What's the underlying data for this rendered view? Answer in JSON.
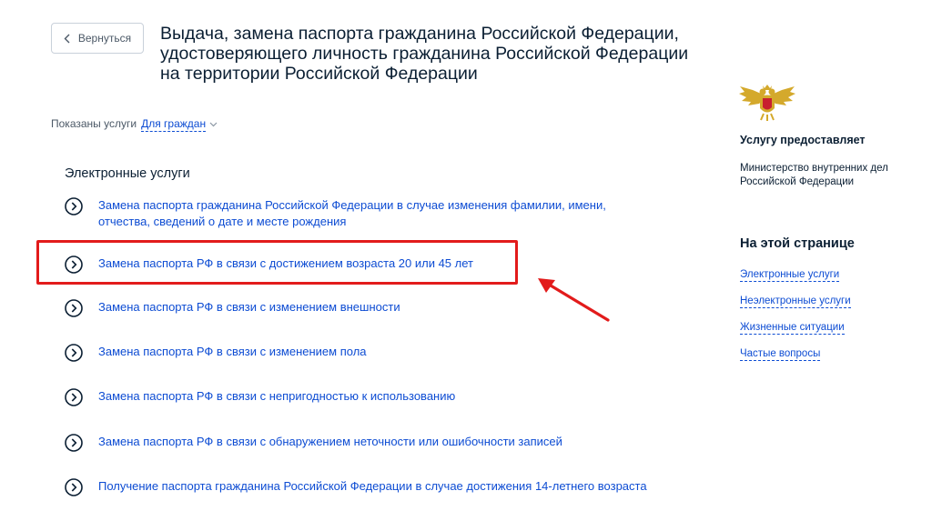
{
  "header": {
    "back_label": "Вернуться",
    "title": "Выдача, замена паспорта гражданина Российской Федерации, удостоверяющего личность гражданина Российской Федерации на территории Российской Федерации"
  },
  "filter": {
    "prefix": "Показаны услуги",
    "value": "Для граждан"
  },
  "main": {
    "section_heading": "Электронные услуги",
    "services": [
      {
        "label": "Замена паспорта гражданина Российской Федерации в случае изменения фамилии, имени, отчества, сведений о дате и месте рождения"
      },
      {
        "label": "Замена паспорта РФ в связи с достижением возраста 20 или 45 лет"
      },
      {
        "label": "Замена паспорта РФ в связи с изменением внешности"
      },
      {
        "label": "Замена паспорта РФ в связи с изменением пола"
      },
      {
        "label": "Замена паспорта РФ в связи с непригодностью к использованию"
      },
      {
        "label": "Замена паспорта РФ в связи с обнаружением неточности или ошибочности записей"
      },
      {
        "label": "Получение паспорта гражданина Российской Федерации в случае достижения 14-летнего возраста"
      }
    ]
  },
  "sidebar": {
    "provider_title": "Услугу предоставляет",
    "provider_name": "Министерство внутренних дел Российской Федерации",
    "toc_title": "На этой странице",
    "toc_links": [
      {
        "label": "Электронные услуги"
      },
      {
        "label": "Неэлектронные услуги"
      },
      {
        "label": "Жизненные ситуации"
      },
      {
        "label": "Частые вопросы"
      }
    ]
  },
  "colors": {
    "link": "#0d4cd3",
    "text": "#0b1f33",
    "highlight": "#e21b1b",
    "emblem_gold": "#d4a92c"
  },
  "icons": [
    "chevron-left-icon",
    "chevron-down-icon",
    "circle-arrow-right-icon",
    "coat-of-arms-emblem"
  ]
}
